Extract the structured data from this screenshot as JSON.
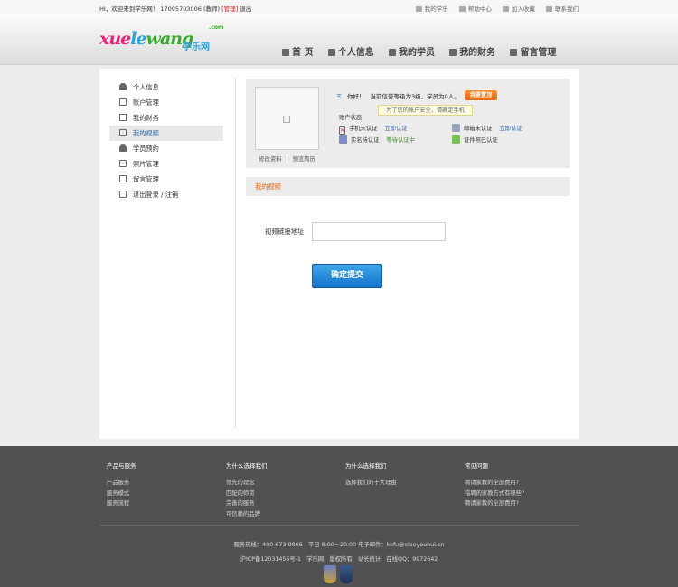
{
  "topbar": {
    "welcome": "HI，欢迎来到学乐网！",
    "user": "17095703006 (教师)",
    "admin": "[管理]",
    "logout": "退出",
    "links": [
      "我的学乐",
      "帮助中心",
      "加入收藏",
      "联系我们"
    ]
  },
  "logo": {
    "xue": "xue",
    "le": "le",
    "wang": "wang",
    "cn": "学乐网",
    "domain": ".com"
  },
  "nav": [
    "首 页",
    "个人信息",
    "我的学员",
    "我的财务",
    "留言管理"
  ],
  "sidebar": [
    {
      "label": "个人信息",
      "icon": "person-icon"
    },
    {
      "label": "账户管理",
      "icon": "account-icon"
    },
    {
      "label": "我的财务",
      "icon": "pen-icon"
    },
    {
      "label": "我的视频",
      "icon": "video-icon",
      "active": true
    },
    {
      "label": "学员预约",
      "icon": "students-icon"
    },
    {
      "label": "照片管理",
      "icon": "photo-icon"
    },
    {
      "label": "留言管理",
      "icon": "mail-icon"
    },
    {
      "label": "退出登录 / 注销",
      "icon": "exit-icon"
    }
  ],
  "profile": {
    "edit_link": "修改资料",
    "separator": "|",
    "preview_link": "预览简历",
    "greeting": "你好！",
    "level_text": "当前信誉等级为3级，学员为0人。",
    "upgrade": "我要置顶",
    "account_status_label": "账户状态",
    "tooltip": "为了您的账户安全，请确定手机",
    "status": {
      "phone": {
        "text": "手机未认证",
        "action": "立即认证"
      },
      "email": {
        "text": "邮箱未认证",
        "action": "立即认证"
      },
      "realname": {
        "text": "实名待认证",
        "action": "等待认证中"
      },
      "cert": {
        "text": "证件照已认证"
      }
    }
  },
  "video": {
    "section_title": "我的视频",
    "field_label": "视频链接地址",
    "field_value": "",
    "submit_label": "确定提交"
  },
  "footer": {
    "columns": [
      {
        "heading": "产品与服务",
        "links": [
          "产品服务",
          "服务模式",
          "服务流程"
        ]
      },
      {
        "heading": "为什么选择我们",
        "links": [
          "领先的理念",
          "匹配的师资",
          "完善的服务",
          "可信赖的品牌"
        ]
      },
      {
        "heading": "为什么选择我们",
        "links": [
          "选择我们的十大理由"
        ]
      },
      {
        "heading": "常见问题",
        "links": [
          "聘请家教的全部费用?",
          "错聘的家教方式有哪些?",
          "聘请家教的全部费用?"
        ]
      }
    ],
    "hotline": "服务热线：400-673-9866　平日 8:00～20:00 电子邮件：kefu@xiaoyouhui.cn",
    "icp": "沪ICP备12031456号-1　学乐网　版权所有　站长统计　在线QQ：9972642"
  },
  "colors": {
    "accent": "#3066b5",
    "orange": "#e8600d",
    "submit": "#1a7fd4",
    "footer_bg": "#515151"
  }
}
